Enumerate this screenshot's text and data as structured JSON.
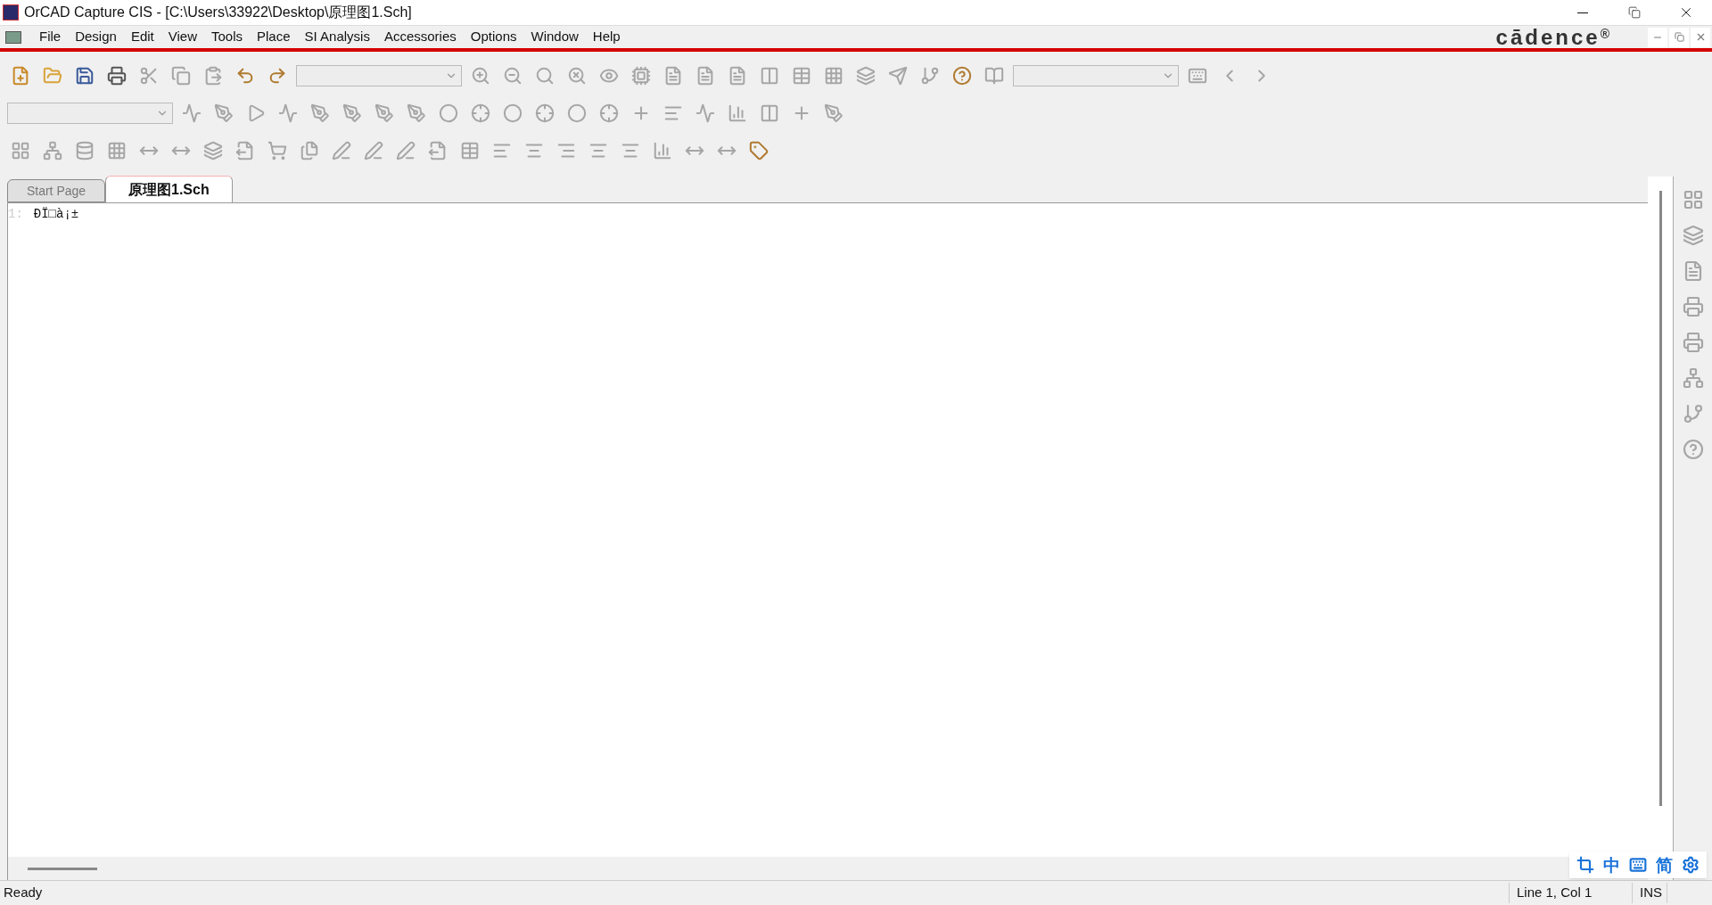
{
  "window": {
    "title": "OrCAD Capture CIS - [C:\\Users\\33922\\Desktop\\原理图1.Sch]"
  },
  "menu": [
    "File",
    "Design",
    "Edit",
    "View",
    "Tools",
    "Place",
    "SI Analysis",
    "Accessories",
    "Options",
    "Window",
    "Help"
  ],
  "logo": {
    "text": "cādence",
    "mark": "®"
  },
  "toolbars": [
    [
      {
        "kind": "button",
        "enabled": true
      },
      {
        "kind": "button",
        "enabled": true
      },
      {
        "kind": "button",
        "enabled": true
      },
      {
        "kind": "button",
        "enabled": true
      },
      {
        "kind": "button",
        "enabled": false
      },
      {
        "kind": "button",
        "enabled": false
      },
      {
        "kind": "button",
        "enabled": false
      },
      {
        "kind": "button",
        "enabled": true
      },
      {
        "kind": "button",
        "enabled": true
      },
      {
        "kind": "combo",
        "enabled": false
      },
      {
        "kind": "button",
        "enabled": false
      },
      {
        "kind": "button",
        "enabled": false
      },
      {
        "kind": "button",
        "enabled": false
      },
      {
        "kind": "button",
        "enabled": false
      },
      {
        "kind": "button",
        "enabled": false
      },
      {
        "kind": "button",
        "enabled": false
      },
      {
        "kind": "button",
        "enabled": false
      },
      {
        "kind": "button",
        "enabled": false
      },
      {
        "kind": "button",
        "enabled": false
      },
      {
        "kind": "button",
        "enabled": false
      },
      {
        "kind": "button",
        "enabled": false
      },
      {
        "kind": "button",
        "enabled": false
      },
      {
        "kind": "button",
        "enabled": false
      },
      {
        "kind": "button",
        "enabled": false
      },
      {
        "kind": "button",
        "enabled": false
      },
      {
        "kind": "button",
        "enabled": true
      },
      {
        "kind": "button",
        "enabled": false
      },
      {
        "kind": "combo",
        "enabled": false
      },
      {
        "kind": "button",
        "enabled": false
      },
      {
        "kind": "button",
        "enabled": false
      },
      {
        "kind": "button",
        "enabled": false
      }
    ],
    [
      {
        "kind": "combo",
        "enabled": false
      },
      {
        "kind": "button",
        "enabled": false
      },
      {
        "kind": "button",
        "enabled": false
      },
      {
        "kind": "button",
        "enabled": false
      },
      {
        "kind": "button",
        "enabled": false
      },
      {
        "kind": "button",
        "enabled": false
      },
      {
        "kind": "button",
        "enabled": false
      },
      {
        "kind": "button",
        "enabled": false
      },
      {
        "kind": "button",
        "enabled": false
      },
      {
        "kind": "button",
        "enabled": false
      },
      {
        "kind": "button",
        "enabled": false
      },
      {
        "kind": "button",
        "enabled": false
      },
      {
        "kind": "button",
        "enabled": false
      },
      {
        "kind": "button",
        "enabled": false
      },
      {
        "kind": "button",
        "enabled": false
      },
      {
        "kind": "button",
        "enabled": false
      },
      {
        "kind": "button",
        "enabled": false
      },
      {
        "kind": "button",
        "enabled": false
      },
      {
        "kind": "button",
        "enabled": false
      },
      {
        "kind": "button",
        "enabled": false
      },
      {
        "kind": "button",
        "enabled": false
      },
      {
        "kind": "button",
        "enabled": false
      }
    ],
    [
      {
        "kind": "button",
        "enabled": false
      },
      {
        "kind": "button",
        "enabled": false
      },
      {
        "kind": "button",
        "enabled": false
      },
      {
        "kind": "button",
        "enabled": false
      },
      {
        "kind": "button",
        "enabled": false
      },
      {
        "kind": "button",
        "enabled": false
      },
      {
        "kind": "button",
        "enabled": false
      },
      {
        "kind": "button",
        "enabled": false
      },
      {
        "kind": "button",
        "enabled": false
      },
      {
        "kind": "button",
        "enabled": false
      },
      {
        "kind": "button",
        "enabled": false
      },
      {
        "kind": "button",
        "enabled": false
      },
      {
        "kind": "button",
        "enabled": false
      },
      {
        "kind": "button",
        "enabled": false
      },
      {
        "kind": "button",
        "enabled": false
      },
      {
        "kind": "button",
        "enabled": false
      },
      {
        "kind": "button",
        "enabled": false
      },
      {
        "kind": "button",
        "enabled": false
      },
      {
        "kind": "button",
        "enabled": false
      },
      {
        "kind": "button",
        "enabled": false
      },
      {
        "kind": "button",
        "enabled": false
      },
      {
        "kind": "button",
        "enabled": false
      },
      {
        "kind": "button",
        "enabled": false
      },
      {
        "kind": "button",
        "enabled": true
      }
    ]
  ],
  "tabs": [
    {
      "label": "Start Page",
      "selected": false
    },
    {
      "label": "原理图1.Sch",
      "selected": true
    }
  ],
  "editor": {
    "lines": [
      {
        "number": "1:",
        "text": "ÐÏ□à¡±"
      }
    ]
  },
  "side_panel": [
    {
      "enabled": false
    },
    {
      "enabled": false
    },
    {
      "enabled": false
    },
    {
      "enabled": false
    },
    {
      "enabled": false
    },
    {
      "enabled": false
    },
    {
      "enabled": false
    },
    {
      "enabled": false
    }
  ],
  "ime_bar": [
    {
      "kind": "icon"
    },
    {
      "kind": "text",
      "text": "中"
    },
    {
      "kind": "icon"
    },
    {
      "kind": "text",
      "text": "简"
    },
    {
      "kind": "icon"
    }
  ],
  "status_bar": {
    "message": "Ready",
    "position": "Line 1, Col 1",
    "mode": "INS"
  }
}
